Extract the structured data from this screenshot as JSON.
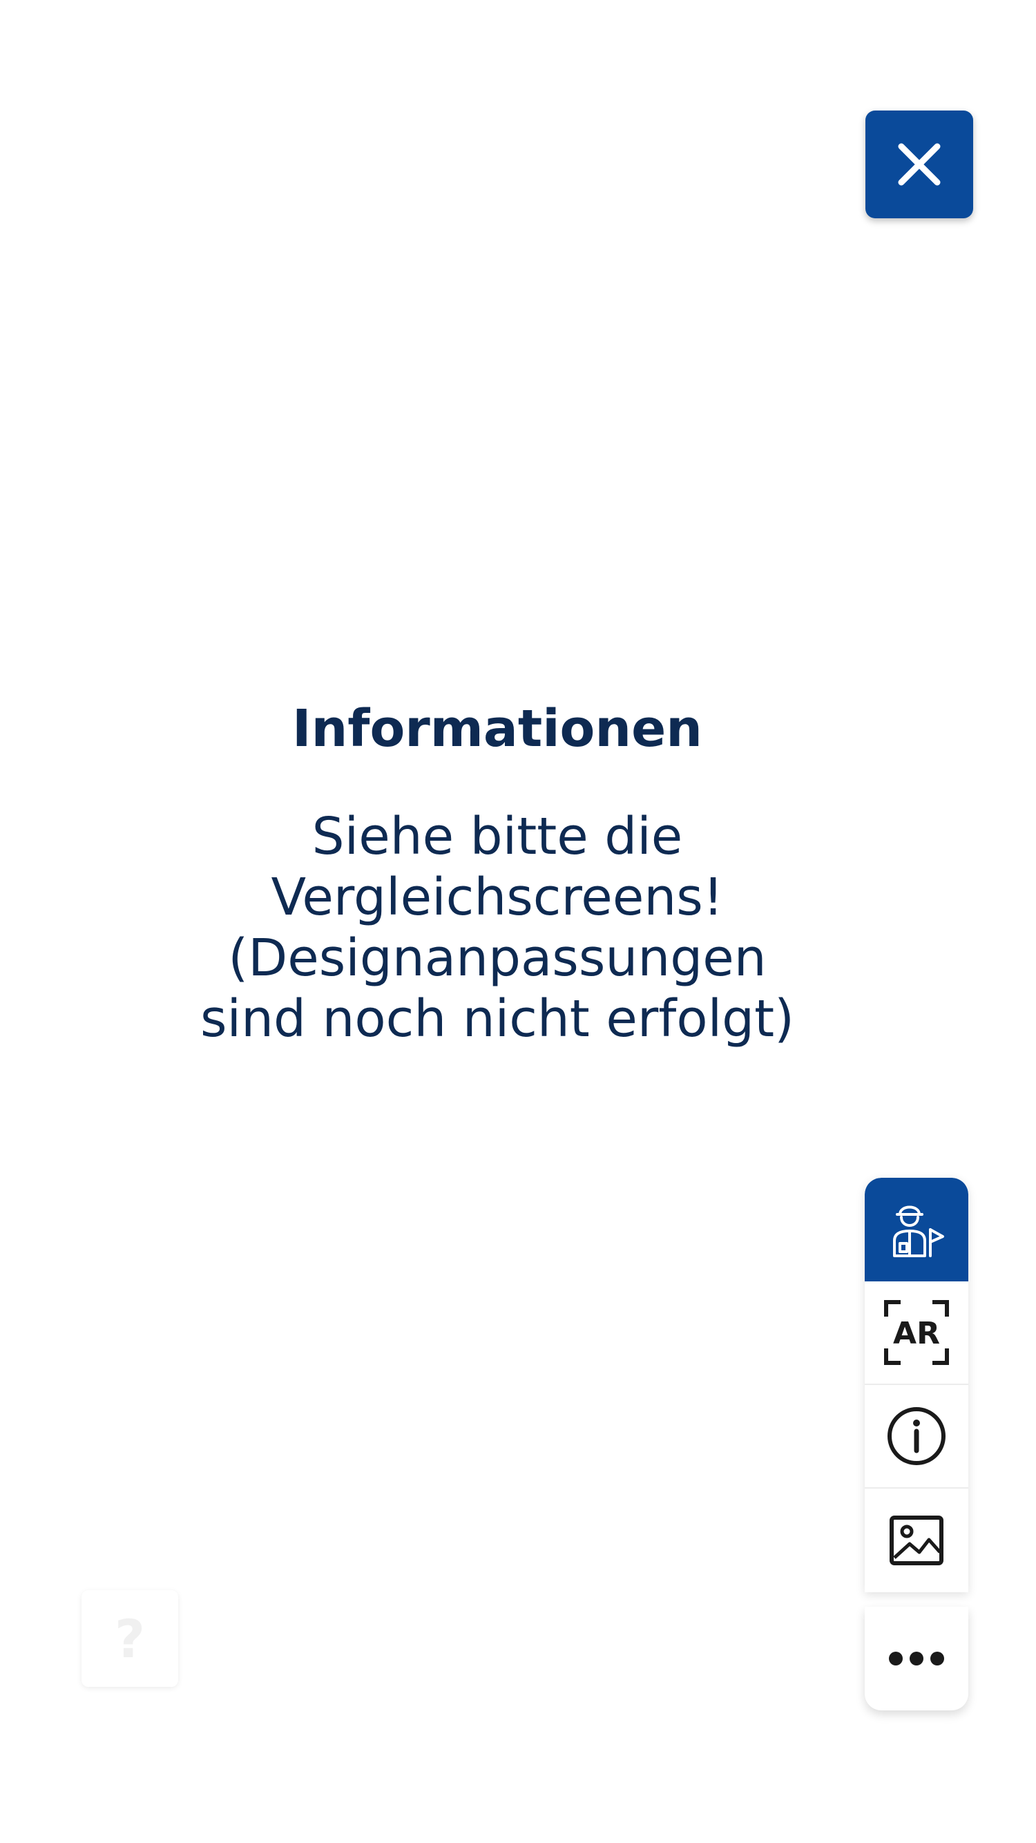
{
  "close_button": {
    "icon": "close-icon",
    "color": "#0a4a9a"
  },
  "info": {
    "title": "Informationen",
    "body_lines": [
      "Siehe bitte die",
      "Vergleichscreens!",
      "(Designanpassungen",
      "sind noch nicht erfolgt)"
    ]
  },
  "help_button": {
    "label": "?",
    "icon": "help-icon"
  },
  "toolbar": {
    "items": [
      {
        "icon": "guide-person-flag-icon",
        "active": true
      },
      {
        "icon": "ar-scan-icon",
        "label": "AR"
      },
      {
        "icon": "info-circle-icon"
      },
      {
        "icon": "image-icon"
      }
    ],
    "more": {
      "icon": "more-dots-icon"
    }
  },
  "colors": {
    "accent": "#0a4a9a",
    "text": "#0e2a52",
    "icon": "#1a1a1a"
  }
}
